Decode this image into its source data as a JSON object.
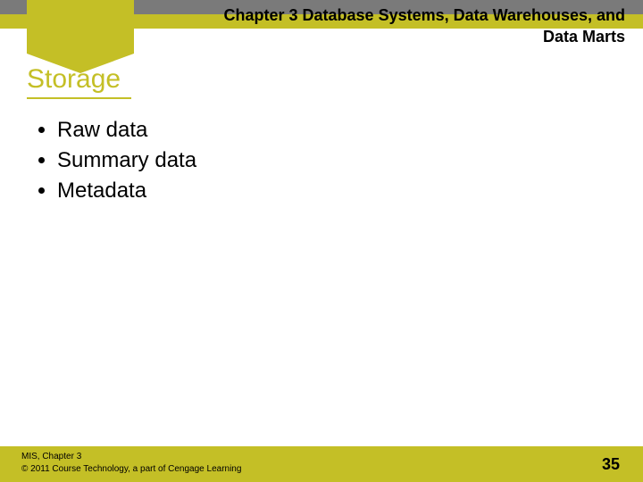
{
  "header": {
    "chapter_line1": "Chapter 3 Database Systems, Data Warehouses, and",
    "chapter_line2": "Data Marts"
  },
  "section": {
    "title": "Storage"
  },
  "bullets": [
    "Raw data",
    "Summary data",
    "Metadata"
  ],
  "footer": {
    "source": "MIS, Chapter 3",
    "copyright": "© 2011 Course Technology, a part of Cengage Learning",
    "page": "35"
  },
  "colors": {
    "accent": "#c4bf26",
    "grey": "#7a7a7a"
  }
}
